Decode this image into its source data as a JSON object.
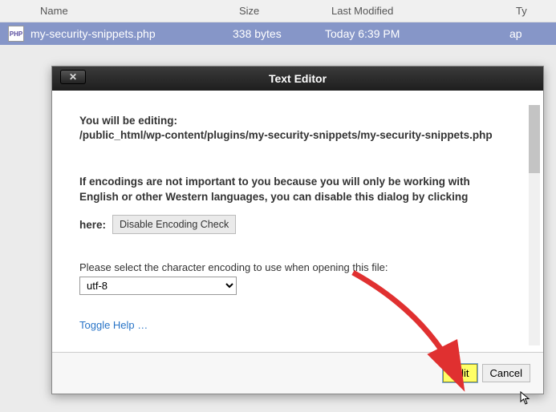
{
  "table": {
    "headers": {
      "name": "Name",
      "size": "Size",
      "lastModified": "Last Modified",
      "type": "Ty"
    },
    "row": {
      "iconText": "PHP",
      "name": "my-security-snippets.php",
      "size": "338 bytes",
      "lastModified": "Today 6:39 PM",
      "type": "ap"
    }
  },
  "dialog": {
    "title": "Text Editor",
    "closeSymbol": "✕",
    "editingLabel": "You will be editing:",
    "editingPath": "/public_html/wp-content/plugins/my-security-snippets/my-security-snippets.php",
    "encodingMessage": "If encodings are not important to you because you will only be working with English or other Western languages, you can disable this dialog by clicking",
    "hereLabel": "here:",
    "disableBtn": "Disable Encoding Check",
    "selectLabel": "Please select the character encoding to use when opening this file:",
    "encodingValue": "utf-8",
    "toggleHelp": "Toggle Help …",
    "editBtn": "Edit",
    "cancelBtn": "Cancel"
  }
}
